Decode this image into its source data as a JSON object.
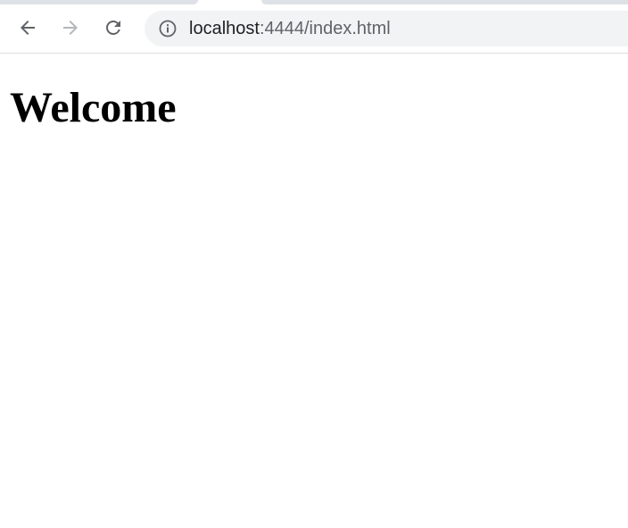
{
  "browser": {
    "address_bar": {
      "host": "localhost",
      "path": ":4444/index.html"
    },
    "icons": {
      "back": "arrow-left-icon",
      "forward": "arrow-right-icon",
      "reload": "reload-icon",
      "site_info": "info-icon"
    },
    "colors": {
      "toolbar_bg": "#ffffff",
      "omnibox_bg": "#f1f3f4",
      "icon_active": "#5f6368",
      "icon_disabled": "#b4b6b9",
      "tab_strip": "#dee1e6"
    }
  },
  "page": {
    "heading": "Welcome"
  }
}
